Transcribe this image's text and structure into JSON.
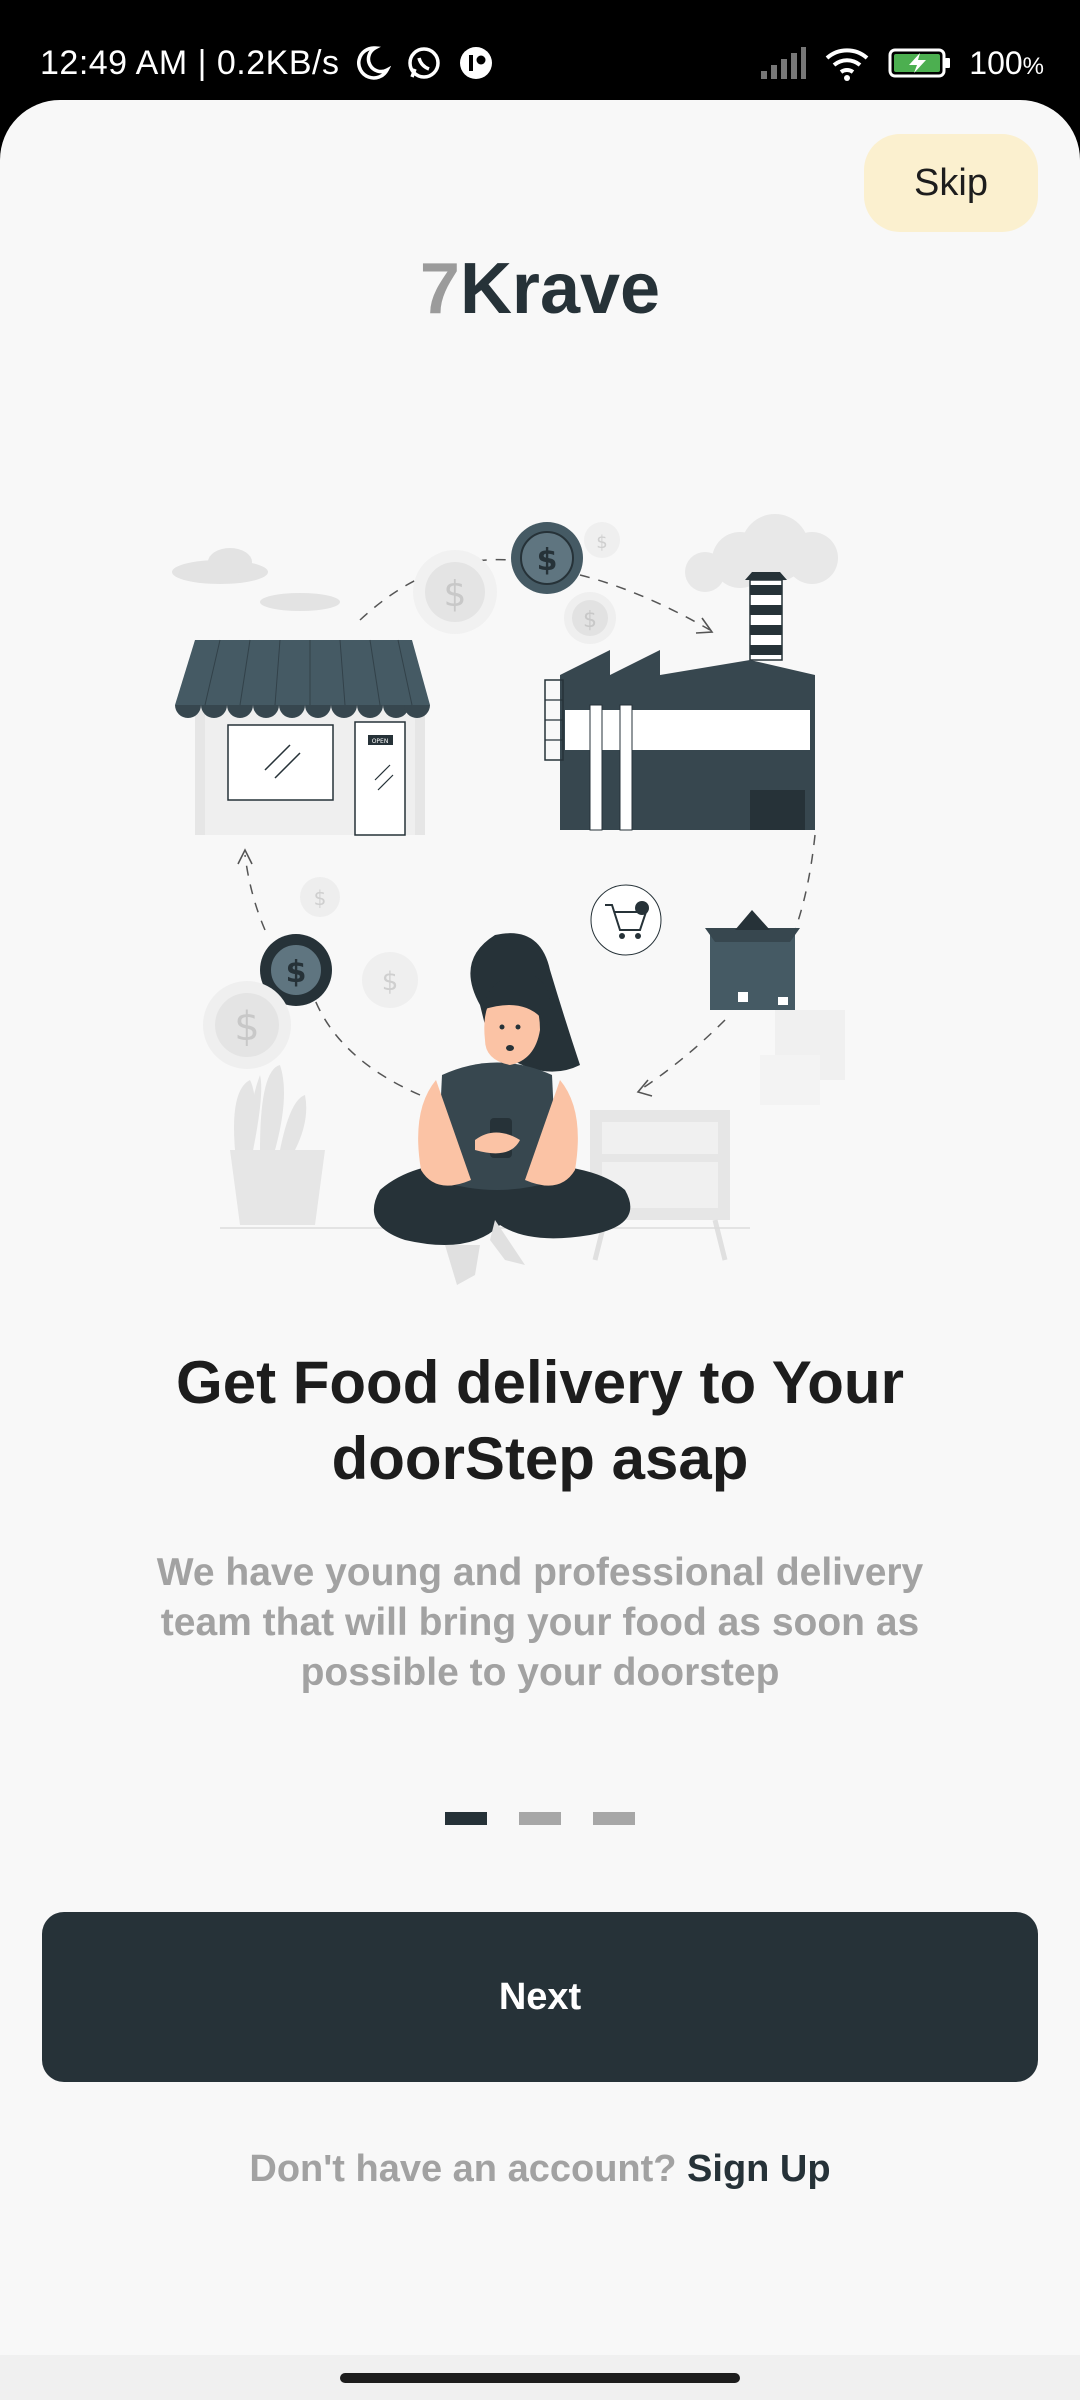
{
  "status_bar": {
    "time_speed": "12:49 AM | 0.2KB/s",
    "battery_percent": "100",
    "battery_suffix": "%",
    "icons": [
      "moon-icon",
      "whatsapp-icon",
      "app-notification-icon",
      "signal-icon",
      "wifi-icon",
      "battery-charging-icon"
    ]
  },
  "header": {
    "skip_label": "Skip",
    "logo_prefix": "7",
    "logo_name": "Krave"
  },
  "onboarding": {
    "illustration": "food-delivery-illustration",
    "sign_open": "OPEN",
    "title": "Get Food delivery to Your doorStep asap",
    "description": "We have young and professional delivery team that will bring your food as soon as possible to your doorstep",
    "page_indicator": {
      "total": 3,
      "current": 1
    }
  },
  "actions": {
    "next_label": "Next",
    "signup_prompt": "Don't have an account?",
    "signup_link": "Sign Up"
  },
  "colors": {
    "primary": "#263238",
    "skip_bg": "#fbf0cf",
    "muted_text": "#a2a2a2",
    "background": "#f8f8f8"
  }
}
